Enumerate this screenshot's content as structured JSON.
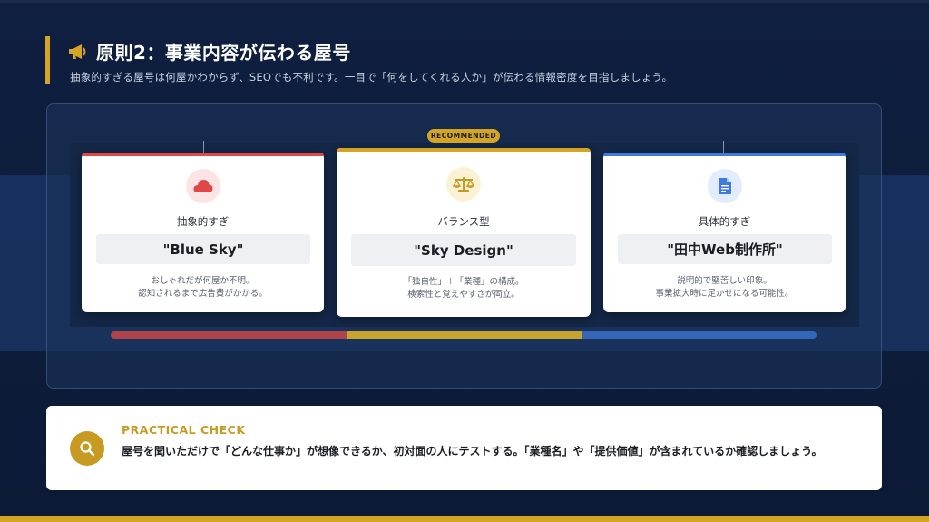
{
  "header": {
    "title": "原則2：事業内容が伝わる屋号",
    "subtitle": "抽象的すぎる屋号は何屋かわからず、SEOでも不利です。一目で「何をしてくれる人か」が伝わる情報密度を目指しましょう。"
  },
  "badge": "RECOMMENDED",
  "cards": [
    {
      "label": "抽象的すぎ",
      "name": "\"Blue Sky\"",
      "desc_line1": "おしゃれだが何屋か不明。",
      "desc_line2": "認知されるまで広告費がかかる。",
      "icon": "cloud-icon",
      "accent": "#e04848"
    },
    {
      "label": "バランス型",
      "name": "\"Sky Design\"",
      "desc_line1": "「独自性」＋「業種」の構成。",
      "desc_line2": "検索性と覚えやすさが両立。",
      "icon": "scale-icon",
      "accent": "#d4a525"
    },
    {
      "label": "具体的すぎ",
      "name": "\"田中Web制作所\"",
      "desc_line1": "説明的で堅苦しい印象。",
      "desc_line2": "事業拡大時に足かせになる可能性。",
      "icon": "document-icon",
      "accent": "#3d7be0"
    }
  ],
  "check": {
    "heading": "PRACTICAL CHECK",
    "text": "屋号を聞いただけで「どんな仕事か」が想像できるか、初対面の人にテストする。「業種名」や「提供価値」が含まれているか確認しましょう。",
    "icon": "search-icon"
  },
  "colors": {
    "gold": "#d4a525",
    "red": "#e04848",
    "blue": "#3d7be0",
    "navy": "#0c1a36"
  }
}
